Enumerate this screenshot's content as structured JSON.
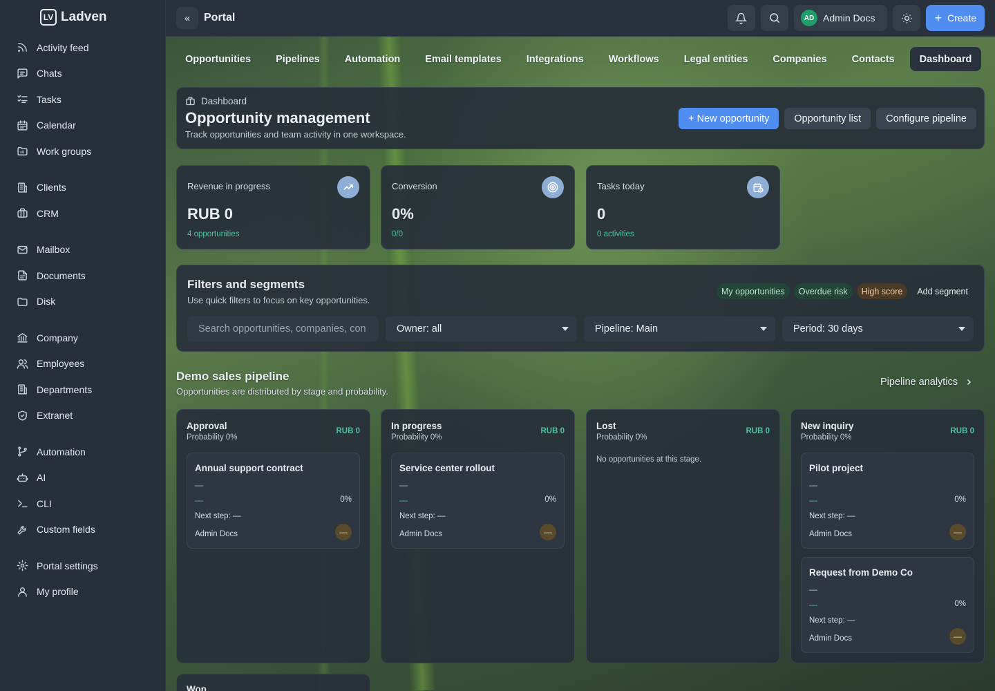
{
  "brand": {
    "name": "Ladven",
    "mark": "LV"
  },
  "sidebar": {
    "groups": [
      [
        {
          "label": "Activity feed",
          "icon": "rss-icon"
        },
        {
          "label": "Chats",
          "icon": "chat-icon"
        },
        {
          "label": "Tasks",
          "icon": "tasks-icon"
        },
        {
          "label": "Calendar",
          "icon": "calendar-icon"
        },
        {
          "label": "Work groups",
          "icon": "folder-icon"
        }
      ],
      [
        {
          "label": "Clients",
          "icon": "building-icon"
        },
        {
          "label": "CRM",
          "icon": "briefcase-icon"
        }
      ],
      [
        {
          "label": "Mailbox",
          "icon": "mail-icon"
        },
        {
          "label": "Documents",
          "icon": "document-icon"
        },
        {
          "label": "Disk",
          "icon": "disk-icon"
        }
      ],
      [
        {
          "label": "Company",
          "icon": "bank-icon"
        },
        {
          "label": "Employees",
          "icon": "users-icon"
        },
        {
          "label": "Departments",
          "icon": "building-icon"
        },
        {
          "label": "Extranet",
          "icon": "shield-icon"
        }
      ],
      [
        {
          "label": "Automation",
          "icon": "branch-icon"
        },
        {
          "label": "AI",
          "icon": "robot-icon"
        },
        {
          "label": "CLI",
          "icon": "terminal-icon"
        },
        {
          "label": "Custom fields",
          "icon": "wrench-icon"
        }
      ],
      [
        {
          "label": "Portal settings",
          "icon": "gear-icon"
        },
        {
          "label": "My profile",
          "icon": "user-icon"
        }
      ]
    ]
  },
  "topbar": {
    "title": "Portal",
    "user_initials": "AD",
    "user_name": "Admin Docs",
    "create_label": "Create"
  },
  "tabs": [
    "Opportunities",
    "Pipelines",
    "Automation",
    "Email templates",
    "Integrations",
    "Workflows",
    "Legal entities",
    "Companies",
    "Contacts",
    "Dashboard"
  ],
  "header": {
    "crumb": "Dashboard",
    "title": "Opportunity management",
    "subtitle": "Track opportunities and team activity in one workspace.",
    "new_btn": "+ New opportunity",
    "list_btn": "Opportunity list",
    "config_btn": "Configure pipeline"
  },
  "stats": [
    {
      "label": "Revenue in progress",
      "value": "RUB 0",
      "note": "4 opportunities",
      "icon": "trend-up-icon"
    },
    {
      "label": "Conversion",
      "value": "0%",
      "note": "0/0",
      "icon": "target-icon"
    },
    {
      "label": "Tasks today",
      "value": "0",
      "note": "0 activities",
      "icon": "calendar-clock-icon"
    }
  ],
  "filters": {
    "title": "Filters and segments",
    "subtitle": "Use quick filters to focus on key opportunities.",
    "segments": {
      "mine": "My opportunities",
      "overdue": "Overdue risk",
      "high": "High score",
      "add": "Add segment"
    },
    "search_placeholder": "Search opportunities, companies, con",
    "owner": "Owner: all",
    "pipeline": "Pipeline: Main",
    "period": "Period: 30 days"
  },
  "pipeline": {
    "title": "Demo sales pipeline",
    "subtitle": "Opportunities are distributed by stage and probability.",
    "analytics": "Pipeline analytics",
    "stages": [
      {
        "name": "Approval",
        "prob": "Probability 0%",
        "sum": "RUB 0",
        "empty": "",
        "cards": [
          {
            "title": "Annual support contract",
            "d1": "—",
            "d2": "—",
            "pct": "0%",
            "next": "Next step: —",
            "owner": "Admin Docs",
            "badge": "—"
          }
        ]
      },
      {
        "name": "In progress",
        "prob": "Probability 0%",
        "sum": "RUB 0",
        "empty": "",
        "cards": [
          {
            "title": "Service center rollout",
            "d1": "—",
            "d2": "—",
            "pct": "0%",
            "next": "Next step: —",
            "owner": "Admin Docs",
            "badge": "—"
          }
        ]
      },
      {
        "name": "Lost",
        "prob": "Probability 0%",
        "sum": "RUB 0",
        "empty": "No opportunities at this stage.",
        "cards": []
      },
      {
        "name": "New inquiry",
        "prob": "Probability 0%",
        "sum": "RUB 0",
        "empty": "",
        "cards": [
          {
            "title": "Pilot project",
            "d1": "—",
            "d2": "—",
            "pct": "0%",
            "next": "Next step: —",
            "owner": "Admin Docs",
            "badge": "—"
          },
          {
            "title": "Request from Demo Co",
            "d1": "—",
            "d2": "—",
            "pct": "0%",
            "next": "Next step: —",
            "owner": "Admin Docs",
            "badge": "—"
          }
        ]
      }
    ],
    "won_label": "Won"
  }
}
